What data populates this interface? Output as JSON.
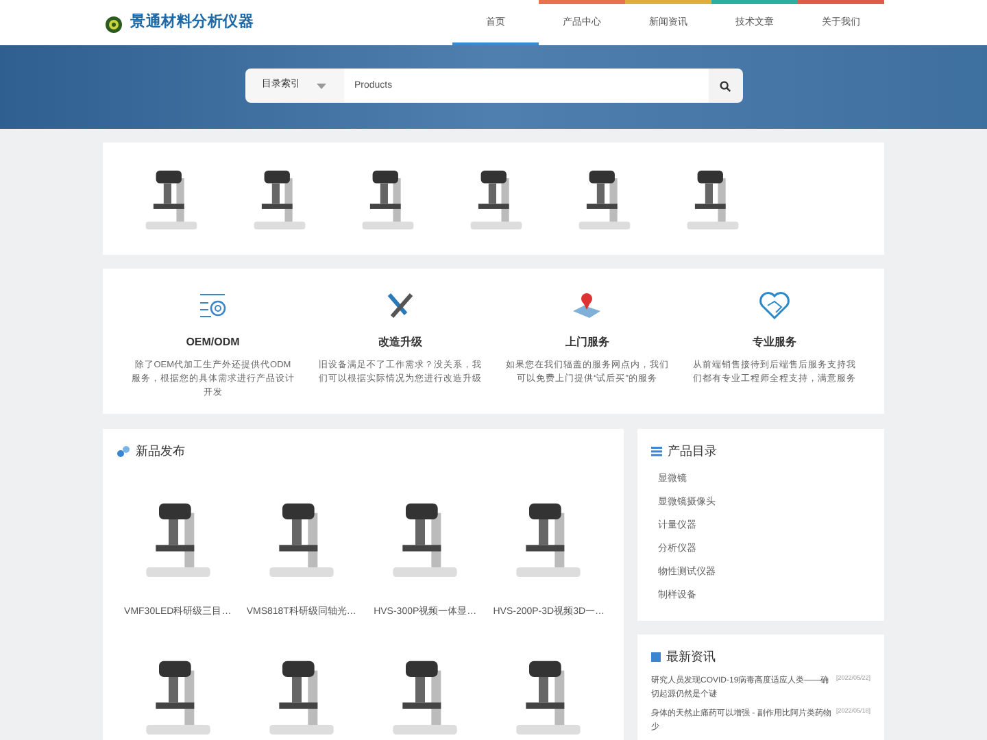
{
  "logo": {
    "text": "景通材料分析仪器"
  },
  "nav": [
    {
      "label": "首页",
      "selected": true
    },
    {
      "label": "产品中心",
      "selected": false,
      "color": "#e8734a"
    },
    {
      "label": "新闻资讯",
      "selected": false,
      "color": "#d9b13b"
    },
    {
      "label": "技术文章",
      "selected": false,
      "color": "#2bb0a0"
    },
    {
      "label": "关于我们",
      "selected": false,
      "color": "#e05a4f"
    }
  ],
  "search": {
    "category": "目录索引",
    "placeholder": "Products"
  },
  "services": [
    {
      "title": "OEM/ODM",
      "text": "除了OEM代加工生产外还提供代ODM服务，根据您的具体需求进行产品设计开发"
    },
    {
      "title": "改造升级",
      "text": "旧设备满足不了工作需求？没关系，我们可以根据实际情况为您进行改造升级"
    },
    {
      "title": "上门服务",
      "text": "如果您在我们辐盖的服务网点内，我们可以免费上门提供“试后买”的服务"
    },
    {
      "title": "专业服务",
      "text": "从前端销售接待到后端售后服务支持我们都有专业工程师全程支持，满意服务"
    }
  ],
  "new_products": {
    "title": "新品发布",
    "items": [
      {
        "name": "VMF30LED科研级三目…"
      },
      {
        "name": "VMS818T科研级同轴光…"
      },
      {
        "name": "HVS-300P视频一体显…"
      },
      {
        "name": "HVS-200P-3D视频3D一…"
      }
    ]
  },
  "catalog": {
    "title": "产品目录",
    "items": [
      "显微镜",
      "显微镜摄像头",
      "计量仪器",
      "分析仪器",
      "物性测试仪器",
      "制样设备"
    ]
  },
  "news": {
    "title": "最新资讯",
    "items": [
      {
        "title": "研究人员发现COVID-19病毒高度适应人类——确切起源仍然是个谜",
        "date": "[2022/05/22]"
      },
      {
        "title": "身体的天然止痛药可以增强 - 副作用比阿片类药物少",
        "date": "[2022/05/18]"
      }
    ]
  }
}
